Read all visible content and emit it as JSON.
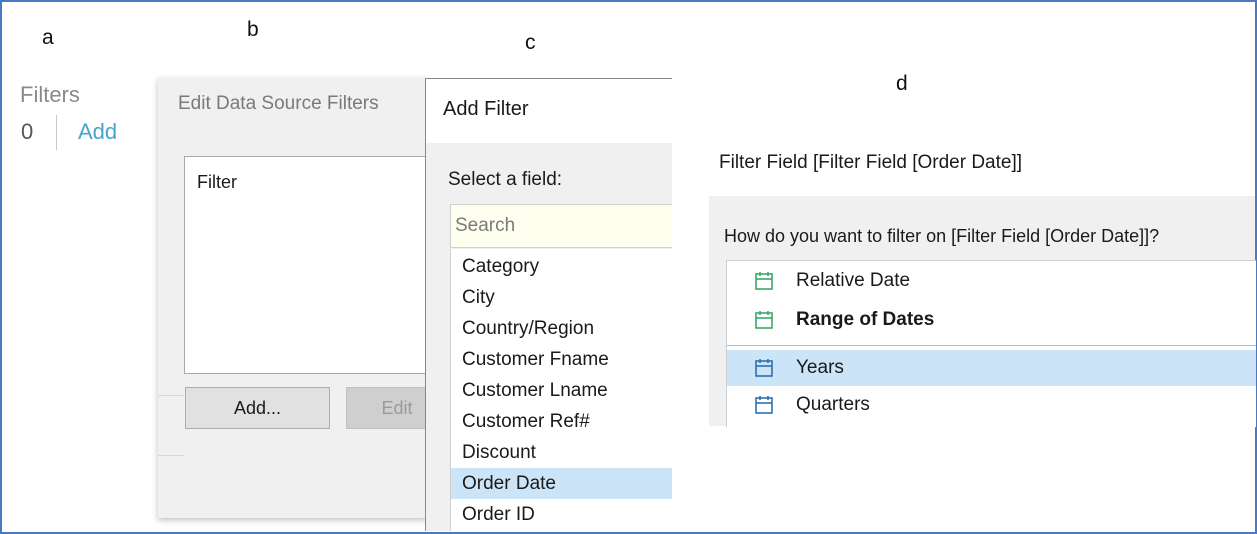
{
  "labels": {
    "a": "a",
    "b": "b",
    "c": "c",
    "d": "d"
  },
  "panel_a": {
    "title": "Filters",
    "count": "0",
    "add": "Add"
  },
  "panel_b": {
    "title": "Edit Data Source Filters",
    "list_header": "Filter",
    "add_button": "Add...",
    "edit_button": "Edit"
  },
  "panel_c": {
    "title": "Add Filter",
    "select_label": "Select a field:",
    "search_placeholder": "Search",
    "fields": [
      "Category",
      "City",
      "Country/Region",
      "Customer Fname",
      "Customer Lname",
      "Customer Ref#",
      "Discount",
      "Order Date",
      "Order ID"
    ],
    "selected": "Order Date"
  },
  "panel_d": {
    "heading": "Filter Field [Filter Field [Order Date]]",
    "question": "How do you want to filter on [Filter Field [Order Date]]?",
    "options": [
      "Relative Date",
      "Range of Dates",
      "Years",
      "Quarters"
    ],
    "selected": "Years",
    "colors": {
      "green_icon": "#3aa86b",
      "blue_icon": "#2f6fb3",
      "selection": "#cce4f7"
    }
  }
}
